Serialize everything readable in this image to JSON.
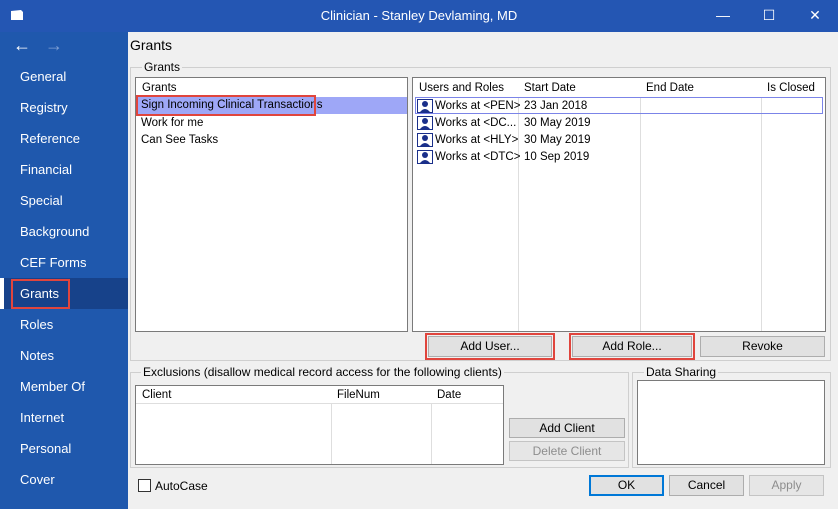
{
  "window": {
    "title": "Clinician - Stanley Devlaming, MD",
    "minimize": "—",
    "maximize": "☐",
    "close": "✕",
    "back": "←",
    "forward": "→"
  },
  "sidebar": {
    "items": [
      {
        "label": "General"
      },
      {
        "label": "Registry"
      },
      {
        "label": "Reference"
      },
      {
        "label": "Financial"
      },
      {
        "label": "Special"
      },
      {
        "label": "Background"
      },
      {
        "label": "CEF Forms"
      },
      {
        "label": "Grants"
      },
      {
        "label": "Roles"
      },
      {
        "label": "Notes"
      },
      {
        "label": "Member Of"
      },
      {
        "label": "Internet"
      },
      {
        "label": "Personal"
      },
      {
        "label": "Cover"
      }
    ],
    "active": "Grants"
  },
  "page": {
    "title": "Grants"
  },
  "grants_group": {
    "label": "Grants",
    "list_header": "Grants",
    "items": [
      {
        "label": "Sign Incoming Clinical Transactions",
        "selected": true
      },
      {
        "label": "Work for me",
        "selected": false
      },
      {
        "label": "Can See Tasks",
        "selected": false
      }
    ],
    "users_table": {
      "columns": [
        "Users and Roles",
        "Start Date",
        "End Date",
        "Is Closed"
      ],
      "rows": [
        {
          "user": "Works at <PEN>",
          "start": "23 Jan 2018",
          "end": "",
          "closed": ""
        },
        {
          "user": "Works at <DC...",
          "start": "30 May 2019",
          "end": "",
          "closed": ""
        },
        {
          "user": "Works at <HLY>",
          "start": "30 May 2019",
          "end": "",
          "closed": ""
        },
        {
          "user": "Works at <DTC>",
          "start": "10 Sep 2019",
          "end": "",
          "closed": ""
        }
      ]
    },
    "buttons": {
      "add_user": "Add User...",
      "add_role": "Add Role...",
      "revoke": "Revoke"
    }
  },
  "exclusions": {
    "label": "Exclusions (disallow medical record access for the following clients)",
    "columns": [
      "Client",
      "FileNum",
      "Date"
    ],
    "add_client": "Add Client",
    "delete_client": "Delete Client"
  },
  "data_sharing": {
    "label": "Data Sharing"
  },
  "footer": {
    "autocase": "AutoCase",
    "autocase_checked": false,
    "ok": "OK",
    "cancel": "Cancel",
    "apply": "Apply"
  },
  "colors": {
    "titlebar": "#2456b3",
    "sidebar": "#1f58ad",
    "sidebar_active": "#17428a",
    "selection": "#9ea7f7",
    "highlight_box": "#e0453d"
  }
}
